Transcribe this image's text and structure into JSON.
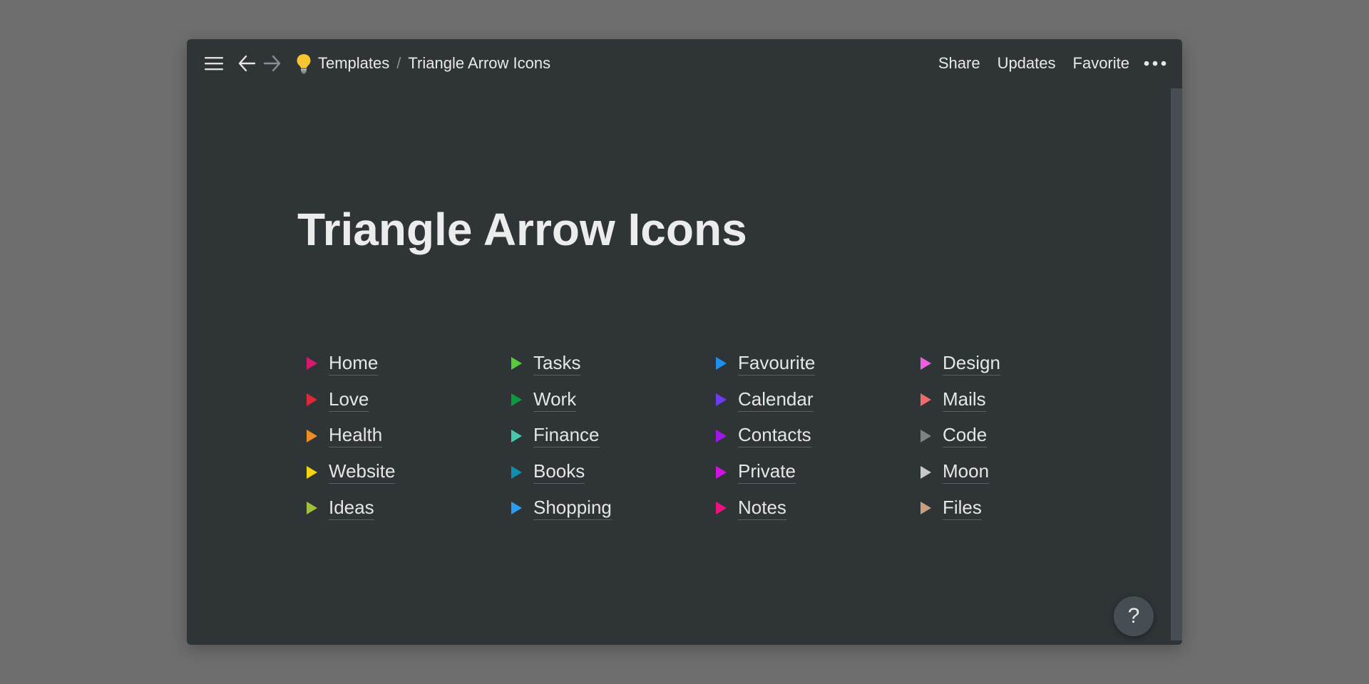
{
  "topbar": {
    "breadcrumb": [
      {
        "label": "Templates"
      },
      {
        "label": "Triangle Arrow Icons"
      }
    ],
    "separator": "/",
    "actions": {
      "share": "Share",
      "updates": "Updates",
      "favorite": "Favorite"
    },
    "icons": {
      "menu": "hamburger-menu-icon",
      "back": "arrow-left-icon",
      "forward": "arrow-right-icon",
      "page": "lightbulb-icon",
      "more": "ellipsis-icon"
    }
  },
  "page": {
    "title": "Triangle Arrow Icons"
  },
  "columns": [
    [
      {
        "label": "Home",
        "color": "#d6196e"
      },
      {
        "label": "Love",
        "color": "#e0283a"
      },
      {
        "label": "Health",
        "color": "#f08c25"
      },
      {
        "label": "Website",
        "color": "#f5d20f"
      },
      {
        "label": "Ideas",
        "color": "#9ec33a"
      }
    ],
    [
      {
        "label": "Tasks",
        "color": "#57cc3a"
      },
      {
        "label": "Work",
        "color": "#0c9a3f"
      },
      {
        "label": "Finance",
        "color": "#44c9b0"
      },
      {
        "label": "Books",
        "color": "#0f8fb0"
      },
      {
        "label": "Shopping",
        "color": "#2f9bf0"
      }
    ],
    [
      {
        "label": "Favourite",
        "color": "#1f8ef0"
      },
      {
        "label": "Calendar",
        "color": "#6a3ef0"
      },
      {
        "label": "Contacts",
        "color": "#a018e8"
      },
      {
        "label": "Private",
        "color": "#cf14e0"
      },
      {
        "label": "Notes",
        "color": "#ea1380"
      }
    ],
    [
      {
        "label": "Design",
        "color": "#ee5fe0"
      },
      {
        "label": "Mails",
        "color": "#f06b6b"
      },
      {
        "label": "Code",
        "color": "#7f8284"
      },
      {
        "label": "Moon",
        "color": "#c9c9c9"
      },
      {
        "label": "Files",
        "color": "#c8a07f"
      }
    ]
  ],
  "help": {
    "label": "?"
  },
  "colors": {
    "background": "#6e6e6e",
    "window": "#2f3437",
    "text": "#e9e9e9"
  }
}
